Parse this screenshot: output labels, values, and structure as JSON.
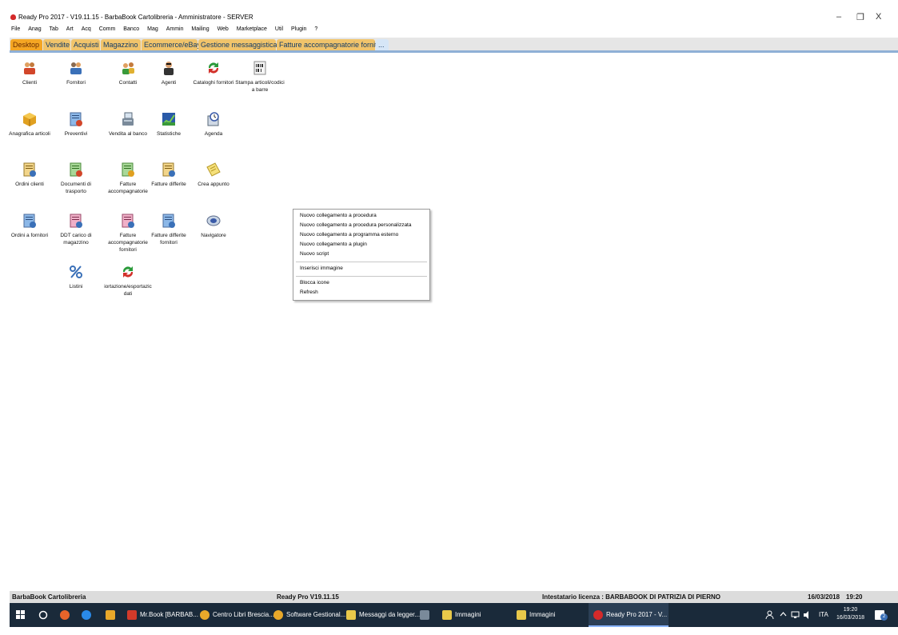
{
  "window": {
    "title": "Ready Pro 2017 - V19.11.15 - BarbaBook Cartolibreria - Amministratore - SERVER",
    "minimize": "–",
    "restore": "❐",
    "close": "X"
  },
  "menu": [
    "File",
    "Anag",
    "Tab",
    "Art",
    "Acq",
    "Comm",
    "Banco",
    "Mag",
    "Ammin",
    "Mailing",
    "Web",
    "Marketplace",
    "Util",
    "Plugin",
    "?"
  ],
  "tabs": [
    "Desktop",
    "Vendite",
    "Acquisti",
    "Magazzino",
    "Ecommerce/eBay",
    "Gestione messaggistica",
    "Fatture accompagnatorie fornitori",
    "..."
  ],
  "desktop": [
    {
      "label": "Clienti",
      "icon": "clienti-icon"
    },
    {
      "label": "Fornitori",
      "icon": "fornitori-icon"
    },
    {
      "label": "Contatti",
      "icon": "contatti-icon"
    },
    {
      "label": "Agenti",
      "icon": "agenti-icon"
    },
    {
      "label": "Cataloghi fornitori",
      "icon": "cataloghi-icon"
    },
    {
      "label": "Stampa articoli/codici a barre",
      "icon": "barcode-icon"
    },
    {
      "label": "Anagrafica articoli",
      "icon": "box-icon"
    },
    {
      "label": "Preventivi",
      "icon": "document-icon"
    },
    {
      "label": "Vendita al banco",
      "icon": "cash-register-icon"
    },
    {
      "label": "Statistiche",
      "icon": "chart-icon"
    },
    {
      "label": "Agenda",
      "icon": "agenda-icon"
    },
    {
      "label": "Ordini clienti",
      "icon": "document-icon"
    },
    {
      "label": "Documenti di trasporto",
      "icon": "document-icon"
    },
    {
      "label": "Fatture accompagnatorie",
      "icon": "document-icon"
    },
    {
      "label": "Fatture differite",
      "icon": "document-icon"
    },
    {
      "label": "Crea appunto",
      "icon": "note-icon"
    },
    {
      "label": "Ordini a fornitori",
      "icon": "document-icon"
    },
    {
      "label": "DDT carico di magazzino",
      "icon": "document-icon"
    },
    {
      "label": "Fatture accompagnatorie fornitori",
      "icon": "document-icon"
    },
    {
      "label": "Fatture differite fornitori",
      "icon": "document-icon"
    },
    {
      "label": "Navigatore",
      "icon": "compass-icon"
    },
    {
      "label": "Listini",
      "icon": "percent-icon"
    },
    {
      "label": "iortazione/esportazic dati",
      "icon": "sync-icon"
    }
  ],
  "context_menu": {
    "group1": [
      "Nuovo collegamento a procedura",
      "Nuovo collegamento a procedura personalizzata",
      "Nuovo collegamento a programma esterno",
      "Nuovo collegamento a plugin",
      "Nuovo script"
    ],
    "group2": [
      "Inserisci immagine"
    ],
    "group3": [
      "Blocca icone",
      "Refresh"
    ]
  },
  "status": {
    "company": "BarbaBook Cartolibreria",
    "version": "Ready Pro V19.11.15",
    "license": "Intestatario licenza : BARBABOOK DI PATRIZIA DI PIERNO",
    "date": "16/03/2018",
    "time": "19:20"
  },
  "taskbar": {
    "apps": [
      "Mr.Book [BARBAB...",
      "Centro Libri Brescia...",
      "Software Gestional...",
      "Messaggi da legger...",
      "Immagini",
      "Immagini",
      "Ready Pro 2017 - V..."
    ],
    "lang": "ITA",
    "clock_time": "19:20",
    "clock_date": "16/03/2018",
    "notifications": "2"
  },
  "colors": {
    "tab_active": "#f5a623",
    "tab": "#f1c46b",
    "taskbar": "#1a2a3a",
    "bluebar": "#8fb0d6"
  }
}
